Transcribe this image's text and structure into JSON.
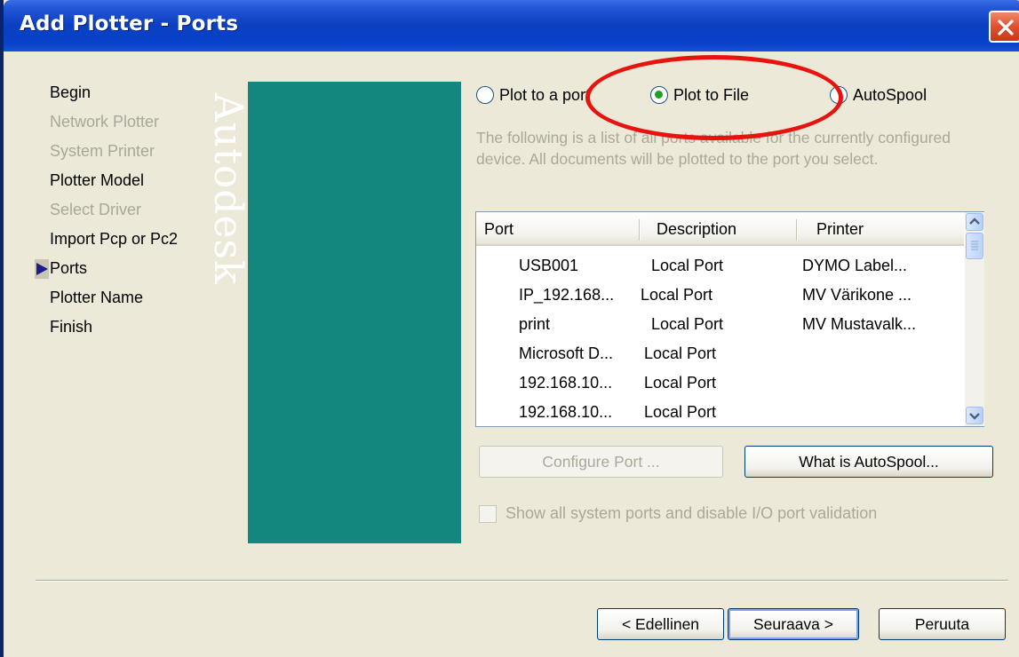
{
  "window": {
    "title": "Add Plotter - Ports"
  },
  "steps": [
    {
      "label": "Begin",
      "state": "enabled"
    },
    {
      "label": "Network Plotter",
      "state": "disabled"
    },
    {
      "label": "System Printer",
      "state": "disabled"
    },
    {
      "label": "Plotter Model",
      "state": "enabled"
    },
    {
      "label": "Select Driver",
      "state": "disabled"
    },
    {
      "label": "Import Pcp or Pc2",
      "state": "enabled"
    },
    {
      "label": "Ports",
      "state": "current"
    },
    {
      "label": "Plotter Name",
      "state": "enabled"
    },
    {
      "label": "Finish",
      "state": "enabled"
    }
  ],
  "brand": {
    "text": "Autodesk",
    "color": "#13877e"
  },
  "options": {
    "plot_to_port": "Plot to a port",
    "plot_to_file": "Plot to File",
    "autospool": "AutoSpool",
    "selected": "plot_to_file"
  },
  "description": "The following is a list of all ports available for the currently configured device. All documents will be plotted to the port you select.",
  "ports_table": {
    "columns": [
      "Port",
      "Description",
      "Printer"
    ],
    "rows": [
      {
        "port": "USB001",
        "description": "Local Port",
        "printer": "DYMO Label..."
      },
      {
        "port": "IP_192.168...",
        "description": "Local Port",
        "printer": "MV Värikone ..."
      },
      {
        "port": "print",
        "description": "Local Port",
        "printer": "MV Mustavalk..."
      },
      {
        "port": "Microsoft D...",
        "description": "Local Port",
        "printer": ""
      },
      {
        "port": "192.168.10...",
        "description": "Local Port",
        "printer": ""
      },
      {
        "port": "192.168.10...",
        "description": "Local Port",
        "printer": ""
      }
    ]
  },
  "buttons": {
    "configure_port": "Configure Port ...",
    "what_is_autospool": "What is AutoSpool...",
    "back": "< Edellinen",
    "next": "Seuraava >",
    "cancel": "Peruuta"
  },
  "checkbox": {
    "label": "Show all system ports and disable I/O port validation",
    "checked": false
  },
  "annotation": {
    "color": "#e8120e"
  }
}
